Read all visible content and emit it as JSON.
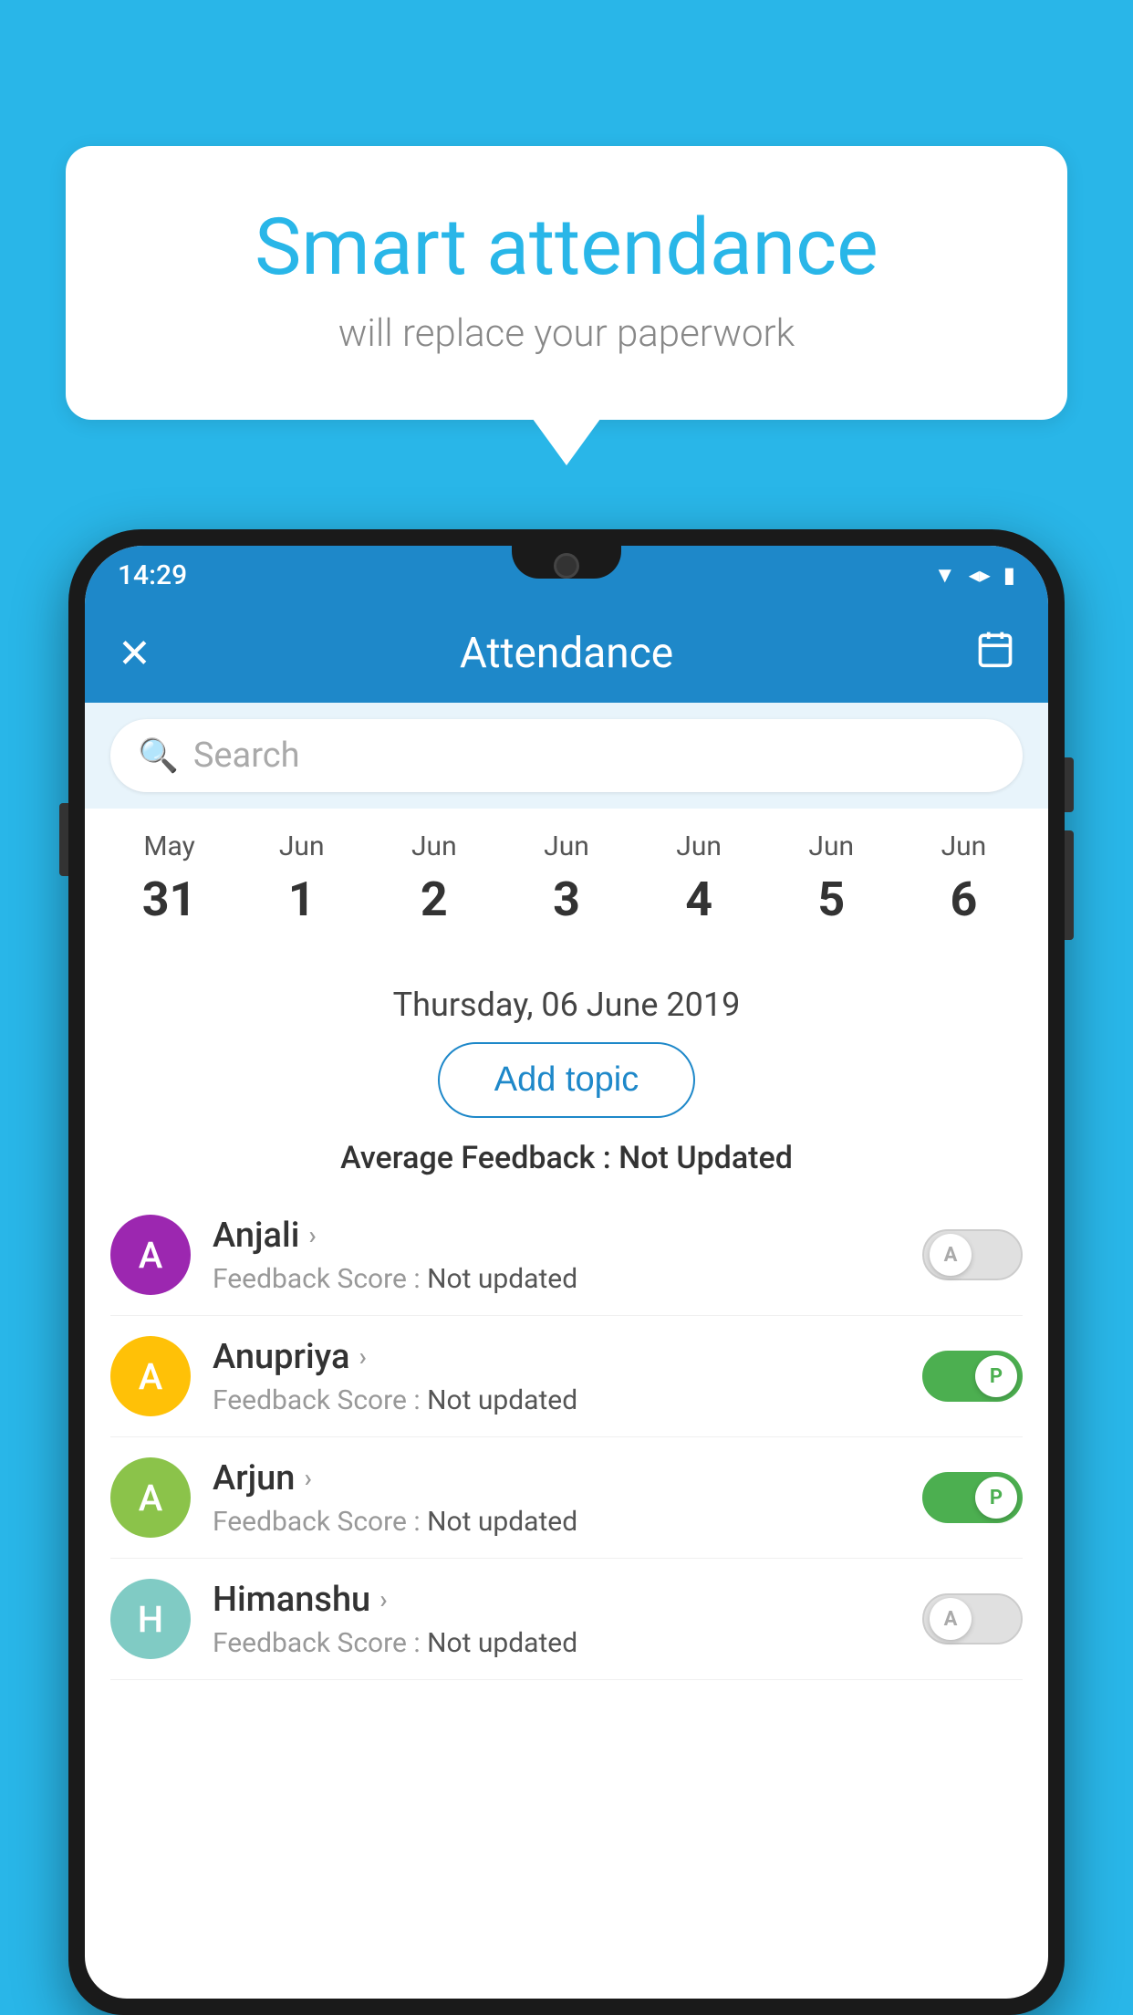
{
  "background_color": "#29b6e8",
  "bubble": {
    "title": "Smart attendance",
    "subtitle": "will replace your paperwork"
  },
  "status_bar": {
    "time": "14:29",
    "icons": [
      "wifi",
      "signal",
      "battery"
    ]
  },
  "toolbar": {
    "title": "Attendance",
    "close_label": "✕",
    "calendar_icon": "📅"
  },
  "search": {
    "placeholder": "Search"
  },
  "calendar": {
    "months": [
      "May",
      "Jun",
      "Jun",
      "Jun",
      "Jun",
      "Jun",
      "Jun"
    ],
    "dates": [
      "31",
      "1",
      "2",
      "3",
      "4",
      "5",
      "6"
    ],
    "today_index": 5,
    "selected_index": 6
  },
  "selected_date_label": "Thursday, 06 June 2019",
  "add_topic_label": "Add topic",
  "avg_feedback_label": "Average Feedback :",
  "avg_feedback_value": "Not Updated",
  "students": [
    {
      "name": "Anjali",
      "avatar_letter": "A",
      "avatar_color": "purple",
      "feedback_label": "Feedback Score :",
      "feedback_value": "Not updated",
      "attendance": "off",
      "attendance_label": "A"
    },
    {
      "name": "Anupriya",
      "avatar_letter": "A",
      "avatar_color": "yellow",
      "feedback_label": "Feedback Score :",
      "feedback_value": "Not updated",
      "attendance": "on",
      "attendance_label": "P"
    },
    {
      "name": "Arjun",
      "avatar_letter": "A",
      "avatar_color": "green",
      "feedback_label": "Feedback Score :",
      "feedback_value": "Not updated",
      "attendance": "on",
      "attendance_label": "P"
    },
    {
      "name": "Himanshu",
      "avatar_letter": "H",
      "avatar_color": "teal",
      "feedback_label": "Feedback Score :",
      "feedback_value": "Not updated",
      "attendance": "off",
      "attendance_label": "A"
    }
  ]
}
